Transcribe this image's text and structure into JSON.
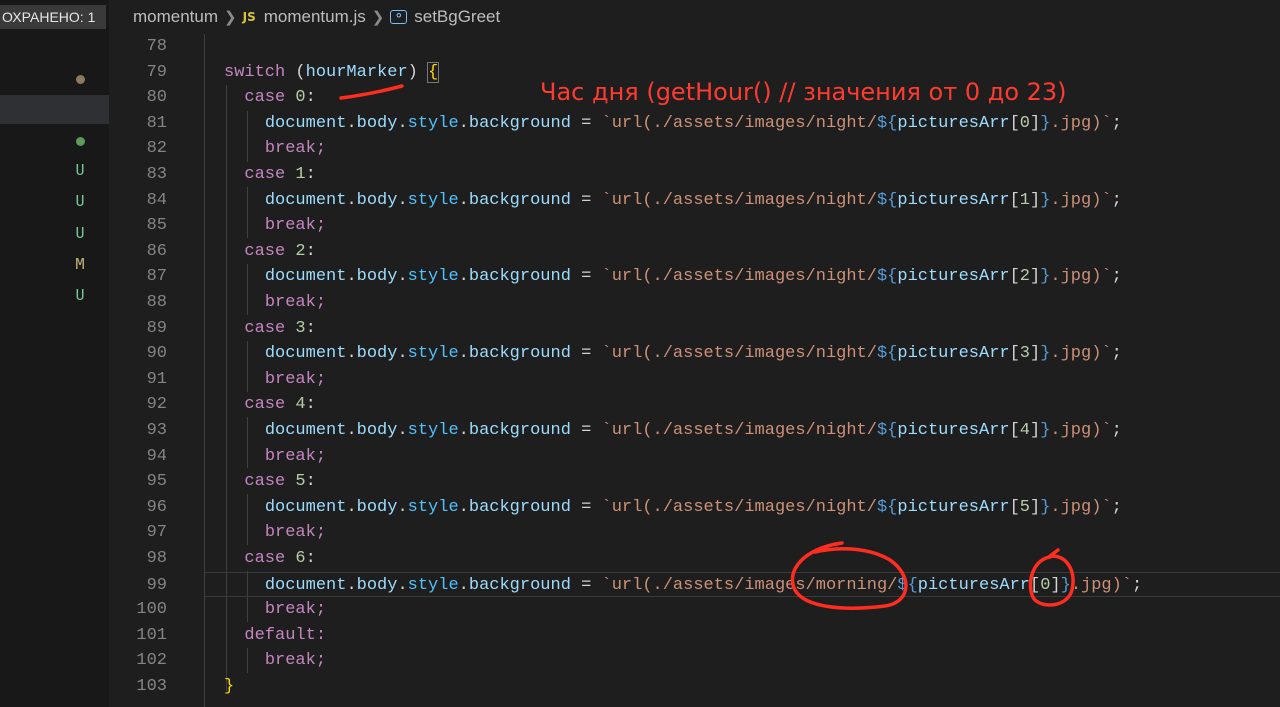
{
  "sidebar": {
    "saved_badge": "ОХРАНЕНО: 1",
    "git_markers": [
      "U",
      "U",
      "U",
      "M",
      "U"
    ],
    "colors": {
      "untracked": "#73c991",
      "modified": "#c5b67b",
      "dot_brown": "#8b7a5e",
      "dot_green": "#5a9a5a"
    }
  },
  "breadcrumb": {
    "folder": "momentum",
    "file_icon": "JS",
    "file": "momentum.js",
    "symbol_icon": "function-symbol-icon",
    "symbol": "setBgGreet"
  },
  "annotation": {
    "note": "Час дня (getHour() // значения от 0 до 23)",
    "color": "#ff3b30"
  },
  "code": {
    "line_numbers": [
      "78",
      "79",
      "80",
      "81",
      "82",
      "83",
      "84",
      "85",
      "86",
      "87",
      "88",
      "89",
      "90",
      "91",
      "92",
      "93",
      "94",
      "95",
      "96",
      "97",
      "98",
      "99",
      "100",
      "101",
      "102",
      "103"
    ],
    "tokens": {
      "switch": "switch",
      "open_paren": "(",
      "var": "hourMarker",
      "close_brace_paren": ")",
      "brace_open": "{",
      "brace_close": "}",
      "case": "case",
      "colon": ":",
      "break": "break;",
      "default": "default:",
      "document": "document",
      "dot": ".",
      "body": "body",
      "style": "style",
      "background": "background",
      "eq": " = ",
      "url_night": "`url(./assets/images/night/",
      "url_morning": "`url(./assets/images/morning/",
      "interp_open": "${",
      "interp_close": "}",
      "arr": "picturesArr",
      "jpg_end": ".jpg)`",
      "semi": ";"
    },
    "cases": [
      "0",
      "1",
      "2",
      "3",
      "4",
      "5",
      "6"
    ],
    "indexes": [
      "0",
      "1",
      "2",
      "3",
      "4",
      "5",
      "0"
    ]
  }
}
